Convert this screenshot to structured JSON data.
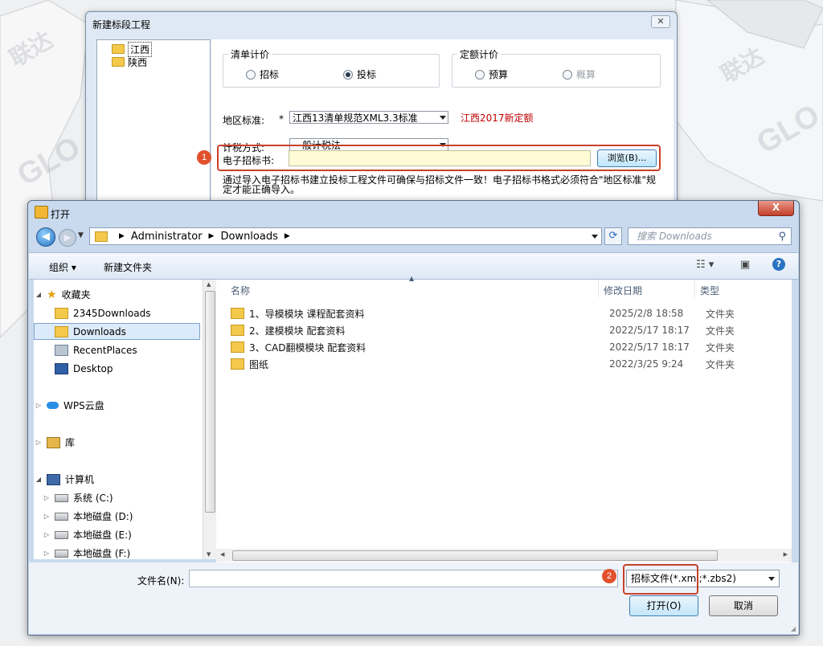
{
  "watermark": {
    "text": "联达",
    "logo": "GLO"
  },
  "back_dialog": {
    "title": "新建标段工程",
    "close": "✕",
    "tree": [
      {
        "label": "江西"
      },
      {
        "label": "陕西"
      }
    ],
    "qingdan": {
      "title": "清单计价",
      "opt1": "招标",
      "opt2": "投标"
    },
    "dinge": {
      "title": "定额计价",
      "opt1": "预算",
      "opt2": "概算"
    },
    "region_label": "地区标准:",
    "region_star": "*",
    "region_value": "江西13清单规范XML3.3标准",
    "region_note": "江西2017新定额",
    "tax_label": "计税方式:",
    "tax_value": "一般计税法",
    "ebid_label": "电子招标书:",
    "browse_label": "浏览(B)...",
    "note": "通过导入电子招标书建立投标工程文件可确保与招标文件一致！电子招标书格式必须符合\"地区标准\"规定才能正确导入。",
    "badge": "1"
  },
  "open_dialog": {
    "title": "打开",
    "close": "X",
    "address": {
      "part1": "Administrator",
      "part2": "Downloads"
    },
    "search_placeholder": "搜索 Downloads",
    "toolbar": {
      "organize": "组织 ▾",
      "new_folder": "新建文件夹"
    },
    "nav": {
      "favorites": "收藏夹",
      "fav_items": [
        "2345Downloads",
        "Downloads",
        "RecentPlaces",
        "Desktop"
      ],
      "wps": "WPS云盘",
      "lib": "库",
      "computer": "计算机",
      "drives": [
        "系统 (C:)",
        "本地磁盘 (D:)",
        "本地磁盘 (E:)",
        "本地磁盘 (F:)"
      ]
    },
    "columns": {
      "name": "名称",
      "date": "修改日期",
      "type": "类型"
    },
    "files": [
      {
        "name": "1、导模模块 课程配套资料",
        "date": "2025/2/8 18:58",
        "type": "文件夹"
      },
      {
        "name": "2、建模模块 配套资料",
        "date": "2022/5/17 18:17",
        "type": "文件夹"
      },
      {
        "name": "3、CAD翻模模块 配套资料",
        "date": "2022/5/17 18:17",
        "type": "文件夹"
      },
      {
        "name": "图纸",
        "date": "2022/3/25 9:24",
        "type": "文件夹"
      }
    ],
    "filename_label": "文件名(N):",
    "filename_value": "",
    "filetype": "招标文件(*.xml;*.zbs2)",
    "open_btn": "打开(O)",
    "cancel_btn": "取消",
    "badge": "2"
  },
  "colors": {
    "highlight": "#c8412a",
    "badge": "#e2512e",
    "region_note": "#c00000"
  }
}
